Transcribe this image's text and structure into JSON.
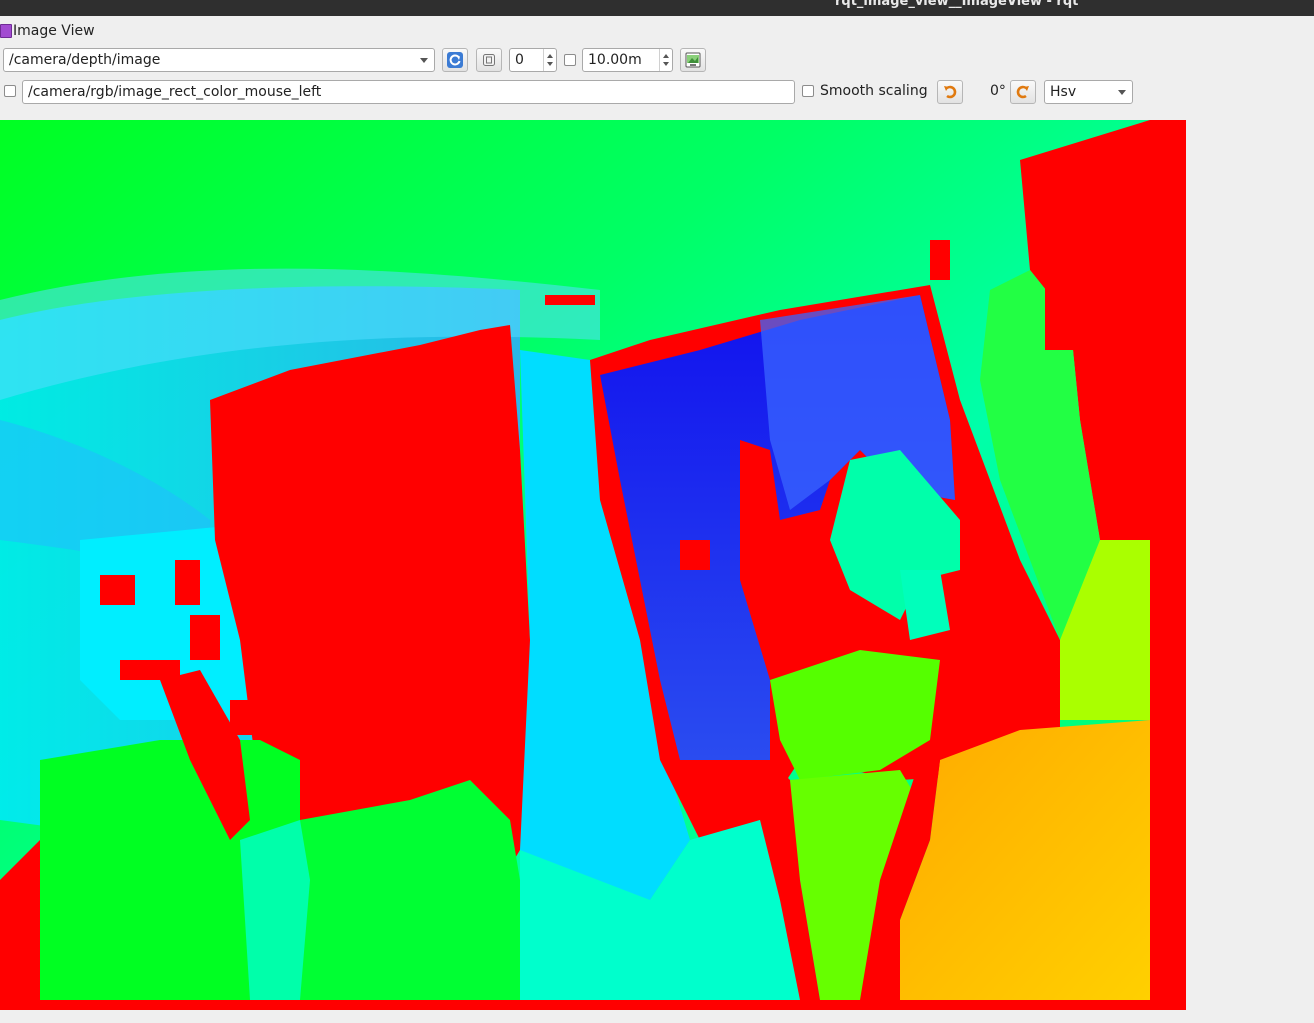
{
  "window": {
    "title": "rqt_image_view__ImageView - rqt"
  },
  "plugin": {
    "title": "Image View",
    "icon": "image-view-plugin-icon"
  },
  "toolbar": {
    "topic_selected": "/camera/depth/image",
    "refresh_icon": "refresh-icon",
    "spin_icon": "zoom-1-icon",
    "min_value": "0",
    "max_value": "10.00m",
    "save_icon": "save-image-icon"
  },
  "toolbar2": {
    "publish_topic": "/camera/rgb/image_rect_color_mouse_left",
    "smooth_scaling_label": "Smooth scaling",
    "rotation_label": "0°",
    "colormap": "Hsv"
  },
  "colors": {
    "accent": "#3b7bd4",
    "background": "#efefef",
    "titlebar": "#2f2f2f"
  }
}
